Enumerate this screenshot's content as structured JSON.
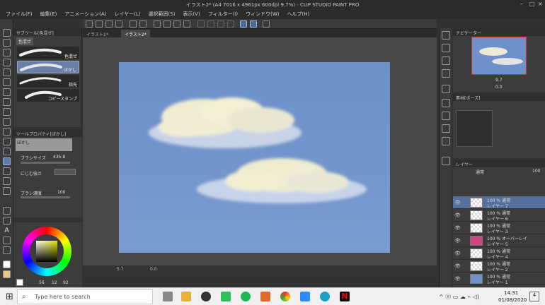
{
  "title": "イラスト2* (A4 7016 x 4961px 600dpi 9.7%) - CLIP STUDIO PAINT PRO",
  "menu": [
    "ファイル(F)",
    "編集(E)",
    "アニメーション(A)",
    "レイヤー(L)",
    "選択範囲(S)",
    "表示(V)",
    "フィルター(I)",
    "ウィンドウ(W)",
    "ヘルプ(H)"
  ],
  "tabs": [
    "イラスト1*",
    "イラスト2*"
  ],
  "subtool": {
    "header": "サブツール[色混ぜ]",
    "group": "色混ぜ",
    "brushes": [
      "色混ぜ",
      "ぼかし",
      "指先",
      "コピースタンプ"
    ]
  },
  "toolprop": {
    "header": "ツールプロパティ[ぼかし]",
    "name": "ぼかし",
    "brush_size_label": "ブラシサイズ",
    "brush_size_value": "435.8",
    "blur_label": "にじむ強さ",
    "density_label": "ブラシ濃度",
    "density_value": "100"
  },
  "color": {
    "sub": "56",
    "h1": "12",
    "h2": "92"
  },
  "status": {
    "zoom": "5.7",
    "angle": "0.0"
  },
  "navigator": {
    "header": "ナビゲーター",
    "zoom": "9.7",
    "angle": "0.0"
  },
  "material": {
    "header": "素材[ポーズ]"
  },
  "layers": {
    "header": "レイヤー",
    "blend": "通常",
    "opacity": "100",
    "list": [
      {
        "pct": "100 % 通常",
        "name": "レイヤー 7",
        "thumb": "blank",
        "selected": true
      },
      {
        "pct": "100 % 通常",
        "name": "レイヤー 6",
        "thumb": "blank",
        "selected": false
      },
      {
        "pct": "100 % 通常",
        "name": "レイヤー 3",
        "thumb": "blank",
        "selected": false
      },
      {
        "pct": "100 % オーバーレイ",
        "name": "レイヤー 5",
        "thumb": "pink",
        "selected": false
      },
      {
        "pct": "100 % 通常",
        "name": "レイヤー 4",
        "thumb": "blank",
        "selected": false
      },
      {
        "pct": "100 % 通常",
        "name": "レイヤー 2",
        "thumb": "blank",
        "selected": false
      },
      {
        "pct": "100 % 通常",
        "name": "レイヤー 1",
        "thumb": "blue",
        "selected": false
      }
    ]
  },
  "taskbar": {
    "search_placeholder": "Type here to search",
    "time": "14:31",
    "date": "01/08/2020",
    "badge": "4"
  }
}
